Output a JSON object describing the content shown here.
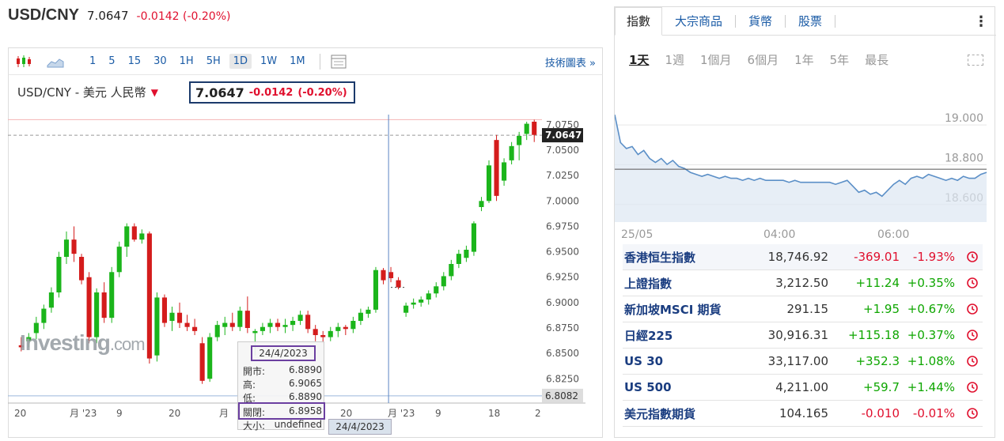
{
  "header": {
    "symbol": "USD/CNY",
    "price": "7.0647",
    "change": "-0.0142",
    "change_pct": "(-0.20%)"
  },
  "toolbar": {
    "periods": [
      "1",
      "5",
      "15",
      "30",
      "1H",
      "5H",
      "1D",
      "1W",
      "1M"
    ],
    "active_period": "1D",
    "tech_link": "技術圖表 »"
  },
  "chart": {
    "title": "USD/CNY - 美元 人民幣",
    "price": "7.0647",
    "change": "-0.0142",
    "change_pct": "(-0.20%)",
    "watermark_main": "Investing",
    "watermark_suffix": ".com",
    "current_price_label": "7.0647",
    "low_price_label": "6.8082",
    "cursor_date": "24/4/2023",
    "colors": {
      "up": "#1bb51b",
      "down": "#d41c1c",
      "cursor": "#5a86c4",
      "current_line": "#999999",
      "high_line": "#f4b4b4"
    }
  },
  "tooltip": {
    "date": "24/4/2023",
    "open_label": "開市:",
    "open": "6.8890",
    "high_label": "高:",
    "high": "6.9065",
    "low_label": "低:",
    "low": "6.8890",
    "close_label": "關閉:",
    "close": "6.8958",
    "volume_label": "大小:",
    "volume": "undefined"
  },
  "chart_data": {
    "type": "candlestick",
    "y_ticks": [
      "7.0750",
      "7.0500",
      "7.0250",
      "7.0000",
      "6.9750",
      "6.9500",
      "6.9250",
      "6.9000",
      "6.8750",
      "6.8500",
      "6.8250"
    ],
    "x_ticks": [
      "20",
      "月 '23",
      "9",
      "20",
      "月",
      "20",
      "月 '23",
      "9",
      "18",
      "2"
    ],
    "ylim": [
      6.805,
      7.085
    ],
    "candles": [
      [
        6.858,
        6.866,
        6.852,
        6.856
      ],
      [
        6.862,
        6.87,
        6.856,
        6.866
      ],
      [
        6.87,
        6.886,
        6.864,
        6.88
      ],
      [
        6.88,
        6.898,
        6.874,
        6.894
      ],
      [
        6.895,
        6.915,
        6.89,
        6.91
      ],
      [
        6.91,
        6.95,
        6.905,
        6.945
      ],
      [
        6.945,
        6.97,
        6.938,
        6.962
      ],
      [
        6.962,
        6.975,
        6.94,
        6.948
      ],
      [
        6.945,
        6.948,
        6.918,
        6.922
      ],
      [
        6.925,
        6.93,
        6.86,
        6.866
      ],
      [
        6.866,
        6.914,
        6.86,
        6.91
      ],
      [
        6.91,
        6.92,
        6.88,
        6.885
      ],
      [
        6.885,
        6.935,
        6.88,
        6.93
      ],
      [
        6.93,
        6.96,
        6.925,
        6.955
      ],
      [
        6.955,
        6.978,
        6.945,
        6.975
      ],
      [
        6.975,
        6.978,
        6.96,
        6.962
      ],
      [
        6.962,
        6.972,
        6.958,
        6.968
      ],
      [
        6.968,
        6.97,
        6.84,
        6.845
      ],
      [
        6.848,
        6.91,
        6.842,
        6.905
      ],
      [
        6.905,
        6.908,
        6.876,
        6.88
      ],
      [
        6.882,
        6.896,
        6.872,
        6.89
      ],
      [
        6.89,
        6.9,
        6.875,
        6.88
      ],
      [
        6.88,
        6.888,
        6.872,
        6.876
      ],
      [
        6.876,
        6.884,
        6.868,
        6.872
      ],
      [
        6.86,
        6.866,
        6.82,
        6.823
      ],
      [
        6.825,
        6.87,
        6.822,
        6.866
      ],
      [
        6.866,
        6.882,
        6.862,
        6.878
      ],
      [
        6.876,
        6.886,
        6.868,
        6.88
      ],
      [
        6.88,
        6.89,
        6.872,
        6.876
      ],
      [
        6.876,
        6.896,
        6.872,
        6.892
      ],
      [
        6.892,
        6.906,
        6.87,
        6.875
      ],
      [
        6.87,
        6.874,
        6.848,
        6.872
      ],
      [
        6.872,
        6.88,
        6.868,
        6.876
      ],
      [
        6.876,
        6.884,
        6.87,
        6.88
      ],
      [
        6.88,
        6.884,
        6.872,
        6.876
      ],
      [
        6.876,
        6.884,
        6.87,
        6.878
      ],
      [
        6.878,
        6.886,
        6.872,
        6.882
      ],
      [
        6.882,
        6.892,
        6.878,
        6.888
      ],
      [
        6.888,
        6.892,
        6.87,
        6.874
      ],
      [
        6.874,
        6.878,
        6.862,
        6.868
      ],
      [
        6.868,
        6.872,
        6.86,
        6.866
      ],
      [
        6.866,
        6.876,
        6.862,
        6.872
      ],
      [
        6.872,
        6.88,
        6.866,
        6.876
      ],
      [
        6.876,
        6.878,
        6.868,
        6.874
      ],
      [
        6.874,
        6.886,
        6.87,
        6.882
      ],
      [
        6.882,
        6.894,
        6.878,
        6.89
      ],
      [
        6.889,
        6.896,
        6.885,
        6.893
      ],
      [
        6.893,
        6.935,
        6.89,
        6.932
      ],
      [
        6.932,
        6.934,
        6.918,
        6.922
      ],
      [
        6.93,
        6.935,
        6.92,
        6.924
      ],
      [
        6.922,
        6.925,
        6.913,
        6.915
      ],
      [
        6.89,
        6.9,
        6.886,
        6.897
      ],
      [
        6.898,
        6.904,
        6.894,
        6.9
      ],
      [
        6.9,
        6.906,
        6.896,
        6.903
      ],
      [
        6.903,
        6.912,
        6.898,
        6.909
      ],
      [
        6.909,
        6.92,
        6.905,
        6.916
      ],
      [
        6.916,
        6.93,
        6.912,
        6.926
      ],
      [
        6.926,
        6.942,
        6.922,
        6.938
      ],
      [
        6.938,
        6.952,
        6.934,
        6.948
      ],
      [
        6.944,
        6.956,
        6.94,
        6.952
      ],
      [
        6.95,
        6.98,
        6.946,
        6.978
      ],
      [
        6.994,
        7.004,
        6.99,
        7.0
      ],
      [
        7.0,
        7.04,
        6.998,
        7.035
      ],
      [
        7.06,
        7.065,
        7.0,
        7.005
      ],
      [
        7.02,
        7.042,
        7.015,
        7.038
      ],
      [
        7.04,
        7.058,
        7.036,
        7.054
      ],
      [
        7.055,
        7.068,
        7.04,
        7.064
      ],
      [
        7.066,
        7.078,
        7.06,
        7.076
      ],
      [
        7.078,
        7.08,
        7.058,
        7.065
      ]
    ],
    "cursor_index": 51,
    "current_price": 7.0647
  },
  "right_panel": {
    "tabs": [
      "指數",
      "大宗商品",
      "貨幣",
      "股票"
    ],
    "active_tab": "指數",
    "more_icon": "⋮",
    "periods": [
      "1天",
      "1週",
      "1個月",
      "6個月",
      "1年",
      "5年",
      "最長"
    ],
    "active_period": "1天",
    "mini_chart": {
      "type": "line",
      "y_ticks": [
        "19.000",
        "18.800",
        "18.600"
      ],
      "x_ticks": [
        "25/05",
        "04:00",
        "06:00"
      ],
      "ylim": [
        18.48,
        19.1
      ],
      "values": [
        19.02,
        18.88,
        18.85,
        18.86,
        18.82,
        18.84,
        18.8,
        18.78,
        18.8,
        18.77,
        18.79,
        18.76,
        18.75,
        18.73,
        18.72,
        18.71,
        18.72,
        18.71,
        18.7,
        18.71,
        18.7,
        18.7,
        18.69,
        18.7,
        18.69,
        18.7,
        18.69,
        18.69,
        18.69,
        18.69,
        18.68,
        18.69,
        18.68,
        18.68,
        18.68,
        18.68,
        18.68,
        18.68,
        18.67,
        18.68,
        18.69,
        18.66,
        18.63,
        18.64,
        18.62,
        18.63,
        18.61,
        18.64,
        18.67,
        18.69,
        18.67,
        18.7,
        18.71,
        18.7,
        18.72,
        18.71,
        18.7,
        18.69,
        18.7,
        18.69,
        18.71,
        18.7,
        18.7,
        18.72,
        18.73
      ],
      "reference": 18.746,
      "colors": {
        "line": "#5b8fc7",
        "fill": "#dde7f2",
        "reference": "#555555"
      }
    },
    "rows": [
      {
        "name": "香港恒生指數",
        "last": "18,746.92",
        "change": "-369.01",
        "pct": "-1.93%",
        "dir": "dn"
      },
      {
        "name": "上證指數",
        "last": "3,212.50",
        "change": "+11.24",
        "pct": "+0.35%",
        "dir": "up"
      },
      {
        "name": "新加坡MSCI 期貨",
        "last": "291.15",
        "change": "+1.95",
        "pct": "+0.67%",
        "dir": "up"
      },
      {
        "name": "日經225",
        "last": "30,916.31",
        "change": "+115.18",
        "pct": "+0.37%",
        "dir": "up"
      },
      {
        "name": "US 30",
        "last": "33,117.00",
        "change": "+352.3",
        "pct": "+1.08%",
        "dir": "up"
      },
      {
        "name": "US 500",
        "last": "4,211.00",
        "change": "+59.7",
        "pct": "+1.44%",
        "dir": "up"
      },
      {
        "name": "美元指數期貨",
        "last": "104.165",
        "change": "-0.010",
        "pct": "-0.01%",
        "dir": "dn"
      }
    ]
  }
}
